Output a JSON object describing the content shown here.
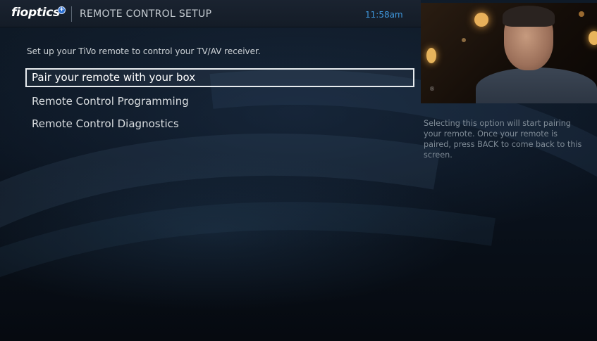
{
  "header": {
    "logo_text": "fioptics",
    "logo_plus": "+",
    "title": "REMOTE CONTROL SETUP",
    "time": "11:58am"
  },
  "main": {
    "instruction": "Set up your TiVo remote to control your TV/AV receiver.",
    "menu": [
      {
        "label": "Pair your remote with your box",
        "selected": true
      },
      {
        "label": "Remote Control Programming",
        "selected": false
      },
      {
        "label": "Remote Control Diagnostics",
        "selected": false
      }
    ]
  },
  "info_panel": {
    "description": "Selecting this option will start pairing your remote. Once your remote is paired, press BACK to come back to this screen."
  },
  "preview": {
    "watermark": "®"
  },
  "colors": {
    "accent_clock": "#3f97dc",
    "menu_text": "#d9dde0",
    "info_text": "#7f8b96",
    "selection_border": "#e8ecef"
  },
  "icons": [
    "fioptics-logo-icon",
    "logo-plus-icon"
  ]
}
